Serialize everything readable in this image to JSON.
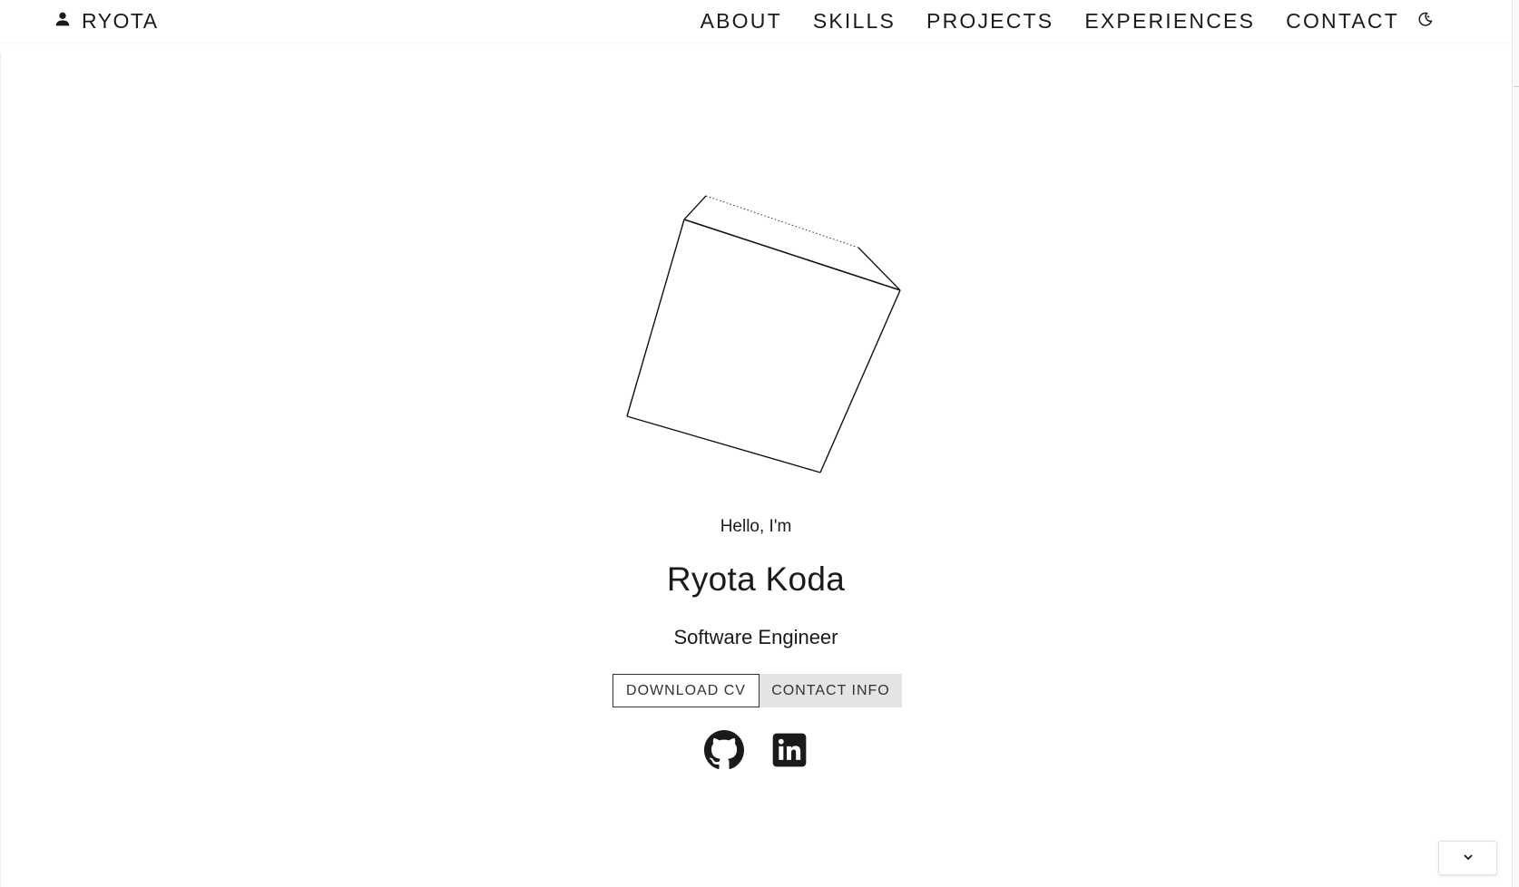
{
  "nav": {
    "brand": "RYOTA",
    "brand_icon": "person-icon",
    "links": [
      "ABOUT",
      "SKILLS",
      "PROJECTS",
      "EXPERIENCES",
      "CONTACT"
    ],
    "theme_toggle_icon": "moon-icon"
  },
  "hero": {
    "graphic": "wireframe-cube",
    "greeting": "Hello, I'm",
    "name": "Ryota Koda",
    "role": "Software Engineer",
    "buttons": {
      "download": "DOWNLOAD CV",
      "contact": "CONTACT INFO"
    },
    "social_icons": [
      "github-icon",
      "linkedin-icon"
    ]
  },
  "scroll_down_icon": "chevron-down-icon",
  "colors": {
    "background": "#ffffff",
    "text": "#1a1a1a",
    "secondary_button_bg": "#e4e4e4"
  }
}
